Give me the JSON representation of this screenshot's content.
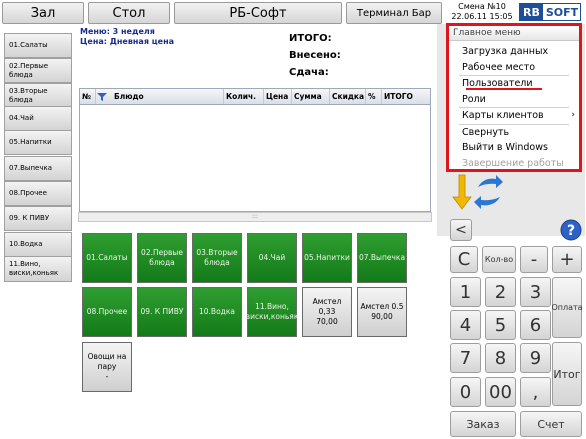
{
  "top": {
    "hall": "Зал",
    "table": "Стол",
    "rbsoft": "РБ-Софт",
    "terminal": "Терминал Бар",
    "shift": "Смена №10",
    "datetime": "22.06.11 15:05",
    "logo_rb": "RB",
    "logo_soft": "SOFT"
  },
  "categories": [
    "01.Салаты",
    "02.Первые блюда",
    "03.Вторые блюда",
    "04.Чай",
    "05.Напитки",
    "07.Выпечка",
    "08.Прочее",
    "09. К ПИВУ",
    "10.Водка",
    "11.Вино, виски,коньяк"
  ],
  "menu_info": {
    "menu": "Меню: 3 неделя",
    "price": "Цена: Дневная цена"
  },
  "totals": {
    "total": "ИТОГО:",
    "paid": "Внесено:",
    "change": "Сдача:"
  },
  "grid_columns": [
    "№",
    "Блюдо",
    "Колич.",
    "Цена",
    "Сумма",
    "Скидка",
    "%",
    "ИТОГО"
  ],
  "scroll_grip": ":::",
  "tiles": {
    "row1": [
      "01.Салаты",
      "02.Первые блюда",
      "03.Вторые блюда",
      "04.Чай",
      "05.Напитки",
      "07.Выпечка"
    ],
    "row2": [
      "08.Прочее",
      "09. К ПИВУ",
      "10.Водка",
      "11.Вино, виски,коньяк",
      "Амстел 0,33\n70,00",
      "Амстел 0.5\n90,00"
    ],
    "row3": [
      "Овощи на пару\n-"
    ]
  },
  "main_menu": {
    "title": "Главное меню",
    "items": [
      "Загрузка данных",
      "Рабочее место",
      "Пользователи",
      "Роли",
      "Карты клиентов",
      "Свернуть",
      "Выйти в Windows",
      "Завершение работы"
    ],
    "submenu_arrow": "›"
  },
  "keypad": {
    "back": "<",
    "help": "?",
    "clear": "C",
    "qty": "Кол-во",
    "minus": "-",
    "plus": "+",
    "digits": [
      "1",
      "2",
      "3",
      "4",
      "5",
      "6",
      "7",
      "8",
      "9",
      "0",
      "00",
      ","
    ],
    "pay": "Оплата",
    "total": "Итог",
    "order": "Заказ",
    "bill": "Счет"
  },
  "colors": {
    "tile_green": "#1e8f22",
    "accent_red": "#e0141c",
    "logo_blue": "#1e4e9a"
  }
}
